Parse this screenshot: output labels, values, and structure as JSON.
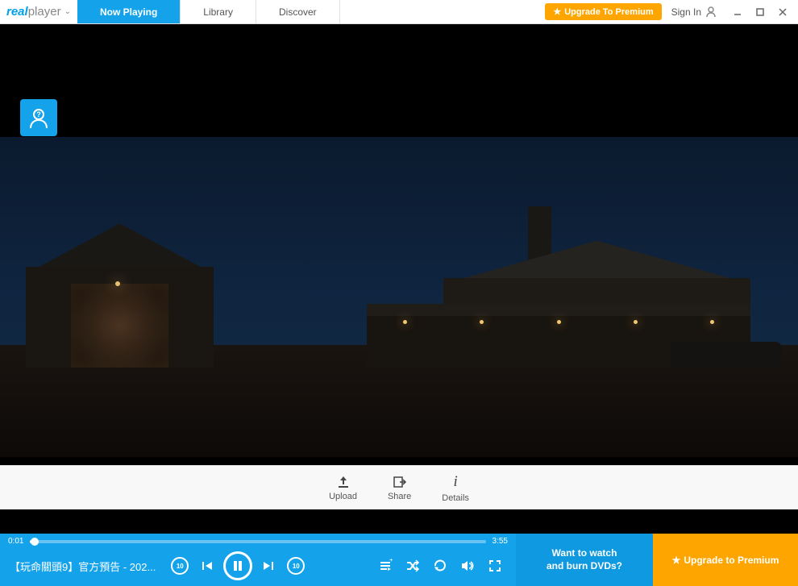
{
  "app": {
    "brand_real": "real",
    "brand_player": "player"
  },
  "tabs": {
    "now_playing": "Now Playing",
    "library": "Library",
    "discover": "Discover"
  },
  "top": {
    "upgrade": "Upgrade To Premium",
    "signin": "Sign In"
  },
  "actions": {
    "upload": "Upload",
    "share": "Share",
    "details": "Details"
  },
  "player": {
    "current_time": "0:01",
    "duration": "3:55",
    "title": "【玩命關頭9】官方預告 - 202...",
    "rewind_amount": "10",
    "forward_amount": "10"
  },
  "promo": {
    "line1": "Want to watch",
    "line2": "and burn DVDs?"
  },
  "bottom_upgrade": "Upgrade to Premium"
}
